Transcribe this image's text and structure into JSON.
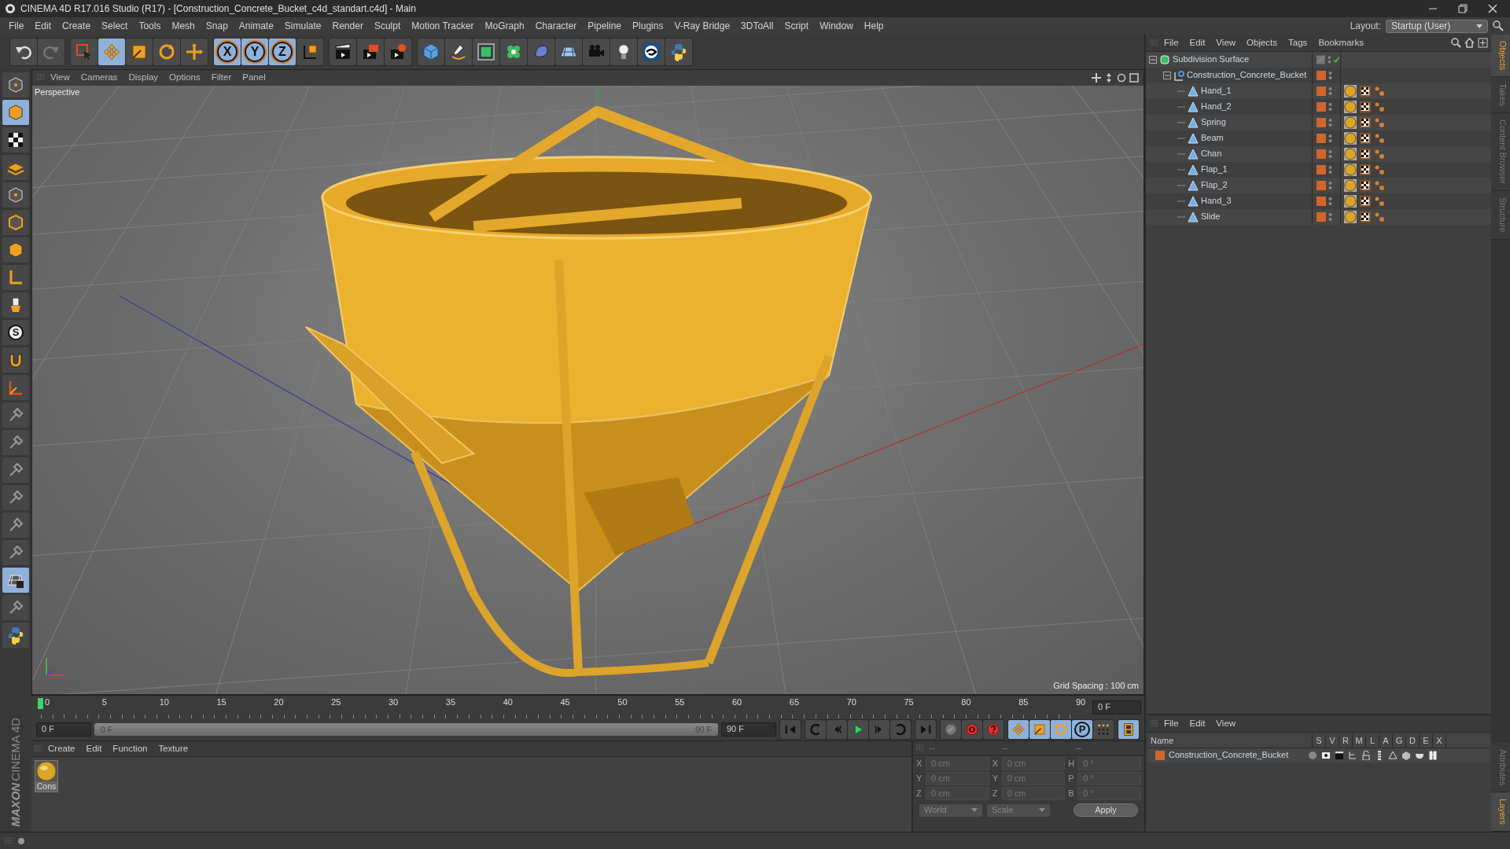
{
  "window": {
    "title": "CINEMA 4D R17.016 Studio (R17) - [Construction_Concrete_Bucket_c4d_standart.c4d] - Main"
  },
  "menu_bar": [
    "File",
    "Edit",
    "Create",
    "Select",
    "Tools",
    "Mesh",
    "Snap",
    "Animate",
    "Simulate",
    "Render",
    "Sculpt",
    "Motion Tracker",
    "MoGraph",
    "Character",
    "Pipeline",
    "Plugins",
    "V-Ray Bridge",
    "3DToAll",
    "Script",
    "Window",
    "Help"
  ],
  "layout": {
    "label": "Layout:",
    "value": "Startup (User)"
  },
  "toolbar": {
    "axis_buttons": [
      "X",
      "Y",
      "Z"
    ]
  },
  "left_tools": {
    "soft_selection": "S"
  },
  "viewport": {
    "menu": [
      "View",
      "Cameras",
      "Display",
      "Options",
      "Filter",
      "Panel"
    ],
    "camera": "Perspective",
    "grid_spacing": "Grid Spacing : 100 cm"
  },
  "timeline": {
    "ticks": [
      "0",
      "5",
      "10",
      "15",
      "20",
      "25",
      "30",
      "35",
      "40",
      "45",
      "50",
      "55",
      "60",
      "65",
      "70",
      "75",
      "80",
      "85",
      "90"
    ],
    "current_frame": "0 F",
    "start": "0 F",
    "range_start": "0 F",
    "range_end": "90 F",
    "range": {
      "level": 1
    },
    "end": "90 F",
    "param_button": "P"
  },
  "material_manager": {
    "menu": [
      "Create",
      "Edit",
      "Function",
      "Texture"
    ],
    "materials": [
      {
        "name": "Cons"
      }
    ]
  },
  "coordinates": {
    "headers": [
      "--",
      "--",
      "--"
    ],
    "columns": [
      [
        {
          "axis": "X",
          "value": "0 cm"
        },
        {
          "axis": "Y",
          "value": "0 cm"
        },
        {
          "axis": "Z",
          "value": "0 cm"
        }
      ],
      [
        {
          "axis": "X",
          "value": "0 cm"
        },
        {
          "axis": "Y",
          "value": "0 cm"
        },
        {
          "axis": "Z",
          "value": "0 cm"
        }
      ],
      [
        {
          "axis": "H",
          "value": "0 °"
        },
        {
          "axis": "P",
          "value": "0 °"
        },
        {
          "axis": "B",
          "value": "0 °"
        }
      ]
    ],
    "mode": "World",
    "transform": "Scale",
    "apply": "Apply"
  },
  "object_manager": {
    "menu": [
      "File",
      "Edit",
      "View",
      "Objects",
      "Tags",
      "Bookmarks"
    ],
    "tree": [
      {
        "name": "Subdivision Surface",
        "kind": "subdivision",
        "expanded": true,
        "children": [
          {
            "name": "Construction_Concrete_Bucket",
            "kind": "null",
            "expanded": true,
            "children": [
              {
                "name": "Hand_1",
                "kind": "polygon"
              },
              {
                "name": "Hand_2",
                "kind": "polygon"
              },
              {
                "name": "Spring",
                "kind": "polygon"
              },
              {
                "name": "Beam",
                "kind": "polygon"
              },
              {
                "name": "Chan",
                "kind": "polygon"
              },
              {
                "name": "Flap_1",
                "kind": "polygon"
              },
              {
                "name": "Flap_2",
                "kind": "polygon"
              },
              {
                "name": "Hand_3",
                "kind": "polygon"
              },
              {
                "name": "Slide",
                "kind": "polygon"
              }
            ]
          }
        ]
      }
    ]
  },
  "layer_manager": {
    "menu": [
      "File",
      "Edit",
      "View"
    ],
    "columns": [
      "Name",
      "S",
      "V",
      "R",
      "M",
      "L",
      "A",
      "G",
      "D",
      "E",
      "X"
    ],
    "layers": [
      {
        "name": "Construction_Concrete_Bucket",
        "color": "#d2652a"
      }
    ]
  },
  "side_tabs_top": [
    {
      "label": "Objects",
      "selected": true
    },
    {
      "label": "Takes",
      "selected": false
    },
    {
      "label": "Content Browser",
      "selected": false
    },
    {
      "label": "Structure",
      "selected": false
    }
  ],
  "side_tabs_bottom": [
    {
      "label": "Attributes",
      "selected": false
    },
    {
      "label": "Layers",
      "selected": true
    }
  ],
  "branding": {
    "company": "MAXON",
    "product": "CINEMA 4D"
  }
}
